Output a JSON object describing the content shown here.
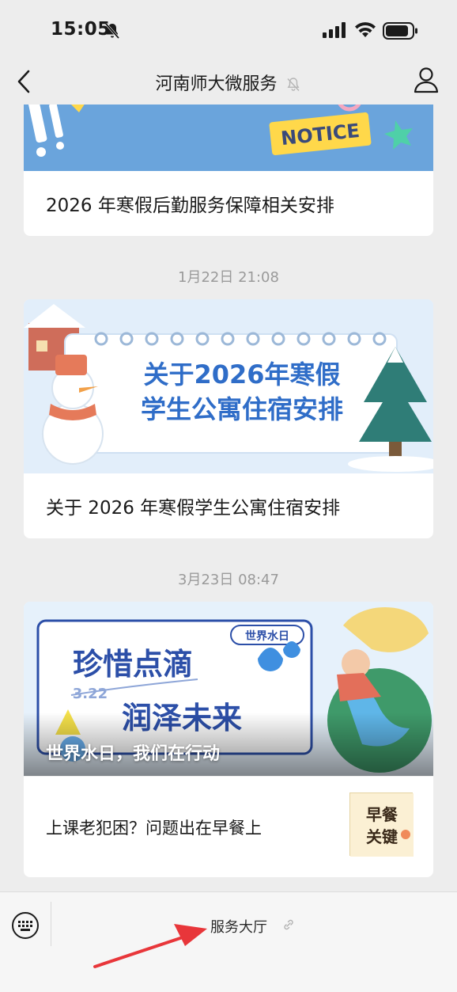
{
  "status": {
    "time": "15:05"
  },
  "nav": {
    "title": "河南师大微服务"
  },
  "feed": {
    "card1": {
      "banner_text": "NOTICE",
      "headline": "2026 年寒假后勤服务保障相关安排"
    },
    "timestamp1": "1月22日 21:08",
    "card2": {
      "banner_line1": "关于2026年寒假",
      "banner_line2": "学生公寓住宿安排",
      "headline": "关于 2026 年寒假学生公寓住宿安排"
    },
    "timestamp2": "3月23日 08:47",
    "card3": {
      "banner_badge": "世界水日",
      "banner_date": "3.22",
      "banner_line1": "珍惜点滴",
      "banner_line2": "润泽未来",
      "overlay_title": "世界水日，我们在行动",
      "sub_title": "上课老犯困？问题出在早餐上",
      "thumb_text1": "早餐",
      "thumb_text2": "关键"
    }
  },
  "bottom_menu": {
    "item_label": "服务大厅"
  },
  "colors": {
    "accent_blue": "#2c6fd1",
    "arrow_red": "#e8363a",
    "background": "#ededed"
  }
}
